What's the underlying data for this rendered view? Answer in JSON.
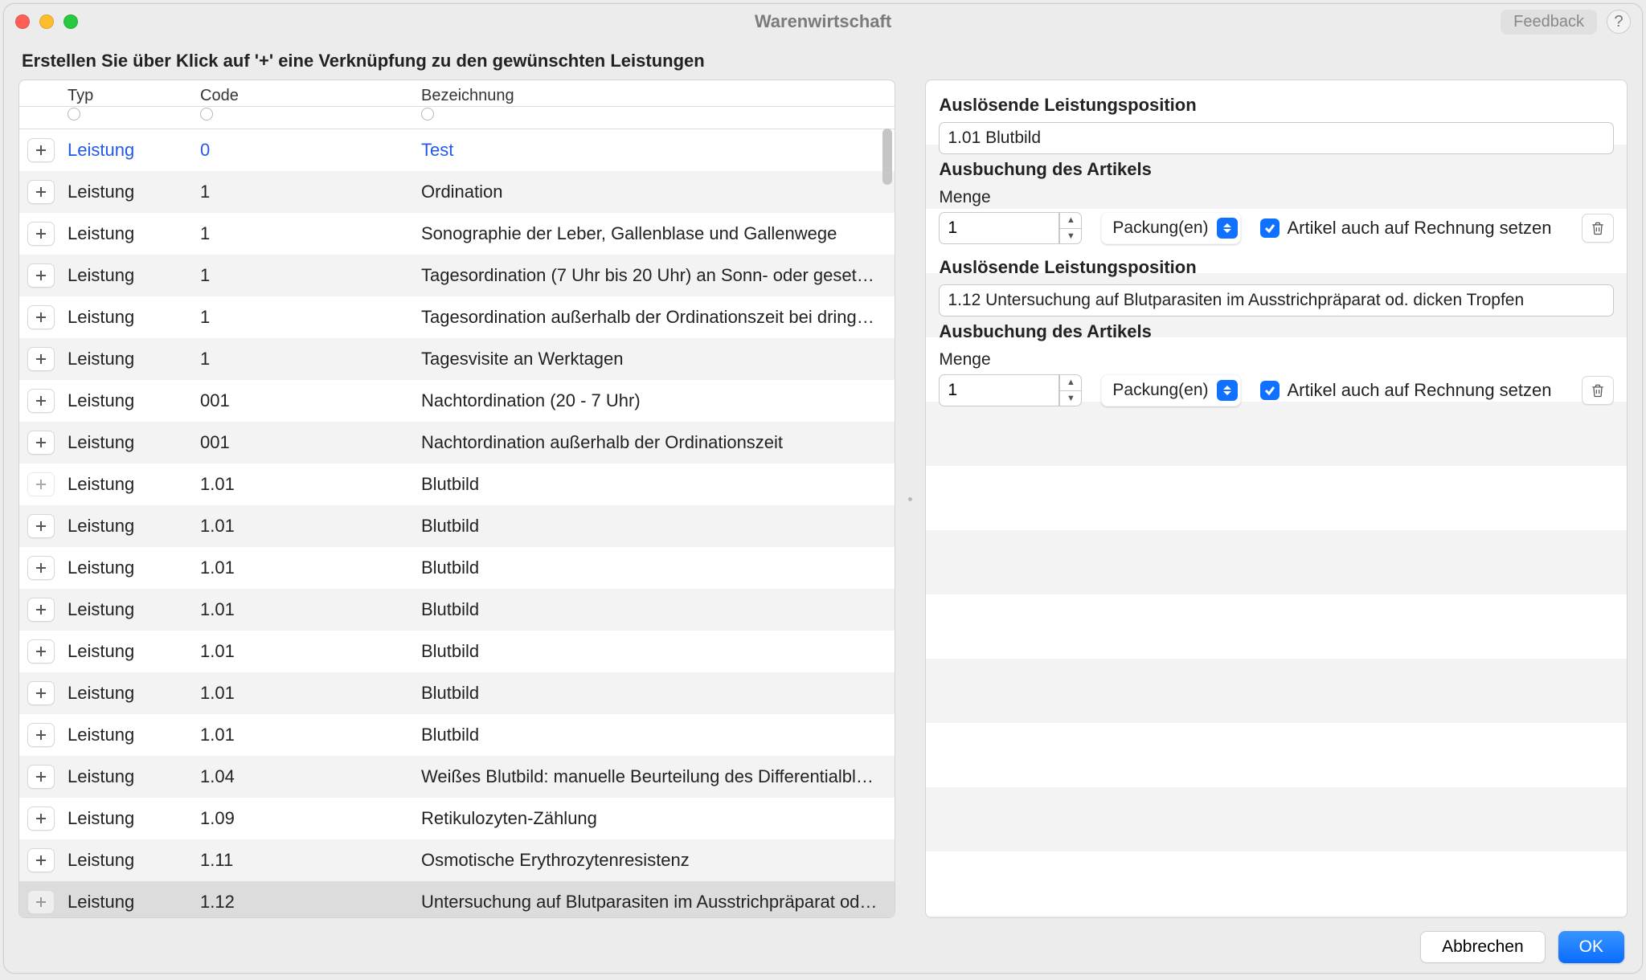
{
  "window": {
    "title": "Warenwirtschaft",
    "feedback": "Feedback"
  },
  "instruction": "Erstellen Sie über Klick auf '+' eine Verknüpfung zu den gewünschten Leistungen",
  "table": {
    "headers": {
      "typ": "Typ",
      "code": "Code",
      "bez": "Bezeichnung"
    },
    "rows": [
      {
        "typ": "Leistung",
        "code": "0",
        "bez": "Test",
        "highlight": true,
        "addEnabled": true
      },
      {
        "typ": "Leistung",
        "code": "1",
        "bez": "Ordination",
        "addEnabled": true
      },
      {
        "typ": "Leistung",
        "code": "1",
        "bez": "Sonographie der Leber, Gallenblase und Gallenwege",
        "addEnabled": true
      },
      {
        "typ": "Leistung",
        "code": "1",
        "bez": "Tagesordination (7 Uhr bis 20 Uhr) an Sonn- oder geset…",
        "addEnabled": true
      },
      {
        "typ": "Leistung",
        "code": "1",
        "bez": "Tagesordination außerhalb der Ordinationszeit bei dring…",
        "addEnabled": true
      },
      {
        "typ": "Leistung",
        "code": "1",
        "bez": "Tagesvisite an Werktagen",
        "addEnabled": true
      },
      {
        "typ": "Leistung",
        "code": "001",
        "bez": "Nachtordination (20 - 7 Uhr)",
        "addEnabled": true
      },
      {
        "typ": "Leistung",
        "code": "001",
        "bez": "Nachtordination außerhalb der Ordinationszeit",
        "addEnabled": true
      },
      {
        "typ": "Leistung",
        "code": "1.01",
        "bez": "Blutbild",
        "addEnabled": false
      },
      {
        "typ": "Leistung",
        "code": "1.01",
        "bez": "Blutbild",
        "addEnabled": true
      },
      {
        "typ": "Leistung",
        "code": "1.01",
        "bez": "Blutbild",
        "addEnabled": true
      },
      {
        "typ": "Leistung",
        "code": "1.01",
        "bez": "Blutbild",
        "addEnabled": true
      },
      {
        "typ": "Leistung",
        "code": "1.01",
        "bez": "Blutbild",
        "addEnabled": true
      },
      {
        "typ": "Leistung",
        "code": "1.01",
        "bez": "Blutbild",
        "addEnabled": true
      },
      {
        "typ": "Leistung",
        "code": "1.01",
        "bez": "Blutbild",
        "addEnabled": true
      },
      {
        "typ": "Leistung",
        "code": "1.04",
        "bez": "Weißes Blutbild: manuelle Beurteilung des Differentialbl…",
        "addEnabled": true
      },
      {
        "typ": "Leistung",
        "code": "1.09",
        "bez": "Retikulozyten-Zählung",
        "addEnabled": true
      },
      {
        "typ": "Leistung",
        "code": "1.11",
        "bez": "Osmotische Erythrozytenresistenz",
        "addEnabled": true
      },
      {
        "typ": "Leistung",
        "code": "1.12",
        "bez": "Untersuchung auf Blutparasiten im Ausstrichpräparat od…",
        "addEnabled": false,
        "selected": true
      }
    ]
  },
  "right": {
    "sections": [
      {
        "posLabel": "Auslösende Leistungsposition",
        "posValue": "1.01 Blutbild",
        "ausLabel": "Ausbuchung des Artikels",
        "mengeLabel": "Menge",
        "mengeValue": "1",
        "unit": "Packung(en)",
        "checkLabel": "Artikel auch auf Rechnung setzen",
        "checked": true
      },
      {
        "posLabel": "Auslösende Leistungsposition",
        "posValue": "1.12 Untersuchung auf Blutparasiten im Ausstrichpräparat od. dicken Tropfen",
        "ausLabel": "Ausbuchung des Artikels",
        "mengeLabel": "Menge",
        "mengeValue": "1",
        "unit": "Packung(en)",
        "checkLabel": "Artikel auch auf Rechnung setzen",
        "checked": true
      }
    ]
  },
  "footer": {
    "cancel": "Abbrechen",
    "ok": "OK"
  }
}
